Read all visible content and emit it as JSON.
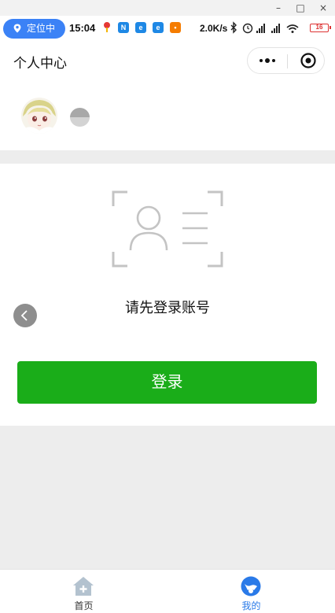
{
  "window": {
    "minimize_glyph": "–",
    "maximize_glyph": "□",
    "close_glyph": "×"
  },
  "status_bar": {
    "location_label": "定位中",
    "time": "15:04",
    "net_speed": "2.0K/s",
    "battery_level": "16",
    "app_icons": [
      "map-pin-icon",
      "n-app-icon",
      "e-app-icon",
      "e-app-icon",
      "orange-app-icon"
    ],
    "colors": {
      "pill": "#3b82f6",
      "battery": "#dd3333"
    }
  },
  "header": {
    "title": "个人中心",
    "capsule": {
      "more_icon": "more-dots-icon",
      "close_icon": "target-circle-icon"
    }
  },
  "profile": {
    "avatar_icon": "anime-avatar",
    "nickname_icon": "gray-chip"
  },
  "login": {
    "prompt": "请先登录账号",
    "button_label": "登录",
    "illustration_icon": "user-scan-icon",
    "colors": {
      "button": "#1aad19"
    }
  },
  "tabbar": {
    "items": [
      {
        "label": "首页",
        "icon": "home-icon",
        "active": false,
        "color": "#333333"
      },
      {
        "label": "我的",
        "icon": "profile-icon",
        "active": true,
        "color": "#2a7ae8"
      }
    ]
  }
}
